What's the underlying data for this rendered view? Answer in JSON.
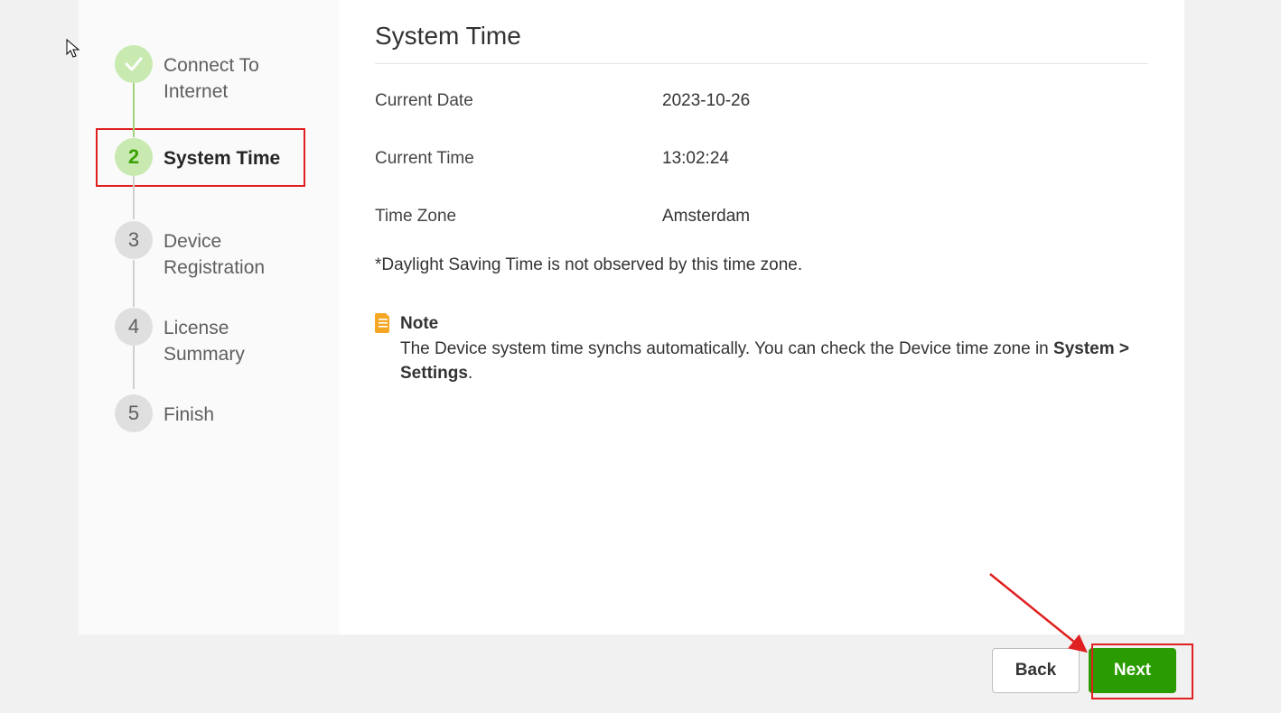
{
  "sidebar": {
    "steps": [
      {
        "num": "",
        "label": "Connect To Internet",
        "state": "done"
      },
      {
        "num": "2",
        "label": "System Time",
        "state": "active"
      },
      {
        "num": "3",
        "label": "Device Registration",
        "state": "pending"
      },
      {
        "num": "4",
        "label": "License Summary",
        "state": "pending"
      },
      {
        "num": "5",
        "label": "Finish",
        "state": "pending"
      }
    ]
  },
  "main": {
    "title": "System Time",
    "fields": {
      "current_date_label": "Current Date",
      "current_date_value": "2023-10-26",
      "current_time_label": "Current Time",
      "current_time_value": "13:02:24",
      "time_zone_label": "Time Zone",
      "time_zone_value": "Amsterdam"
    },
    "dst_note": "*Daylight Saving Time is not observed by this time zone.",
    "note": {
      "title": "Note",
      "body_prefix": "The Device system time synchs automatically. You can check the Device time zone in ",
      "body_bold": "System > Settings",
      "body_suffix": "."
    }
  },
  "footer": {
    "back_label": "Back",
    "next_label": "Next"
  }
}
